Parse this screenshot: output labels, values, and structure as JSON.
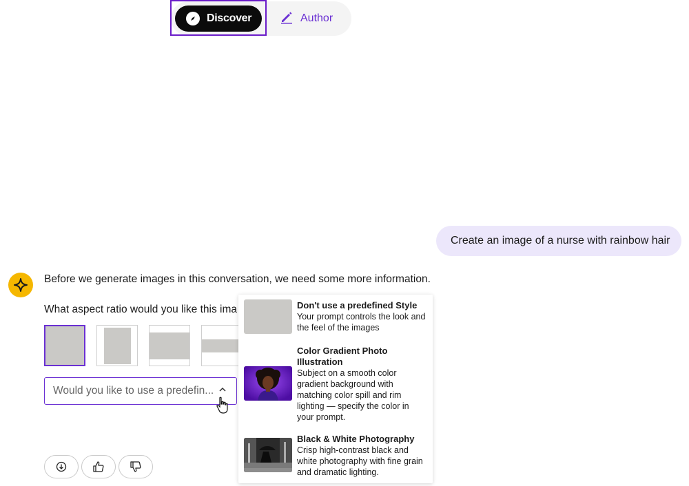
{
  "mode_switch": {
    "discover_label": "Discover",
    "author_label": "Author",
    "active": "Discover"
  },
  "user_message": "Create an image of a nurse with rainbow hair",
  "assistant": {
    "intro": "Before we generate images in this conversation, we need some more information.",
    "aspect_question": "What aspect ratio would you like this ima",
    "aspect_options": [
      "square",
      "portrait",
      "landscape",
      "wide"
    ],
    "style_select": {
      "placeholder": "Would you like to use a predefin...",
      "expanded": true
    },
    "style_options": [
      {
        "title": "Don't use a predefined Style",
        "description": "Your prompt controls the look and the feel of the images"
      },
      {
        "title": "Color Gradient Photo Illustration",
        "description": "Subject on a smooth color gradient background with matching color spill and rim lighting — specify the color in your prompt."
      },
      {
        "title": "Black & White Photography",
        "description": "Crisp high-contrast black and white photography with fine grain and dramatic lighting."
      }
    ]
  },
  "feedback": [
    "download-icon",
    "thumbs-up-icon",
    "thumbs-down-icon"
  ],
  "colors": {
    "accent": "#6a2fd3",
    "avatar": "#f5b700",
    "user_bubble": "#ece7fb",
    "discover_bg": "#0b0b0b"
  }
}
